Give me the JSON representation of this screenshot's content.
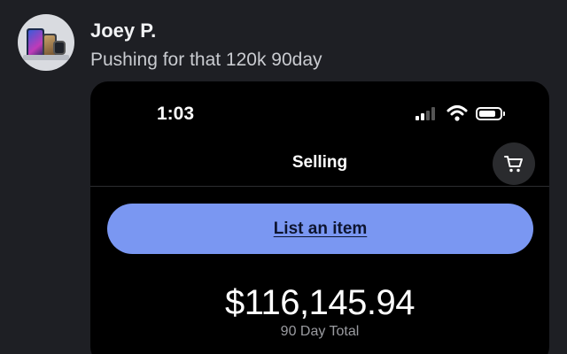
{
  "post": {
    "username": "Joey P.",
    "message": "Pushing for that 120k 90day"
  },
  "screenshot": {
    "status_bar": {
      "time": "1:03",
      "icons": [
        "signal-icon",
        "wifi-icon",
        "battery-icon"
      ]
    },
    "header": {
      "title": "Selling",
      "cart_icon": "cart-icon"
    },
    "list_button_label": "List an item",
    "total_amount": "$116,145.94",
    "total_label": "90 Day Total"
  },
  "colors": {
    "background": "#1e1f24",
    "screenshot_background": "#000000",
    "accent_button": "#7a97f2",
    "muted_text": "#9a9ba0"
  }
}
